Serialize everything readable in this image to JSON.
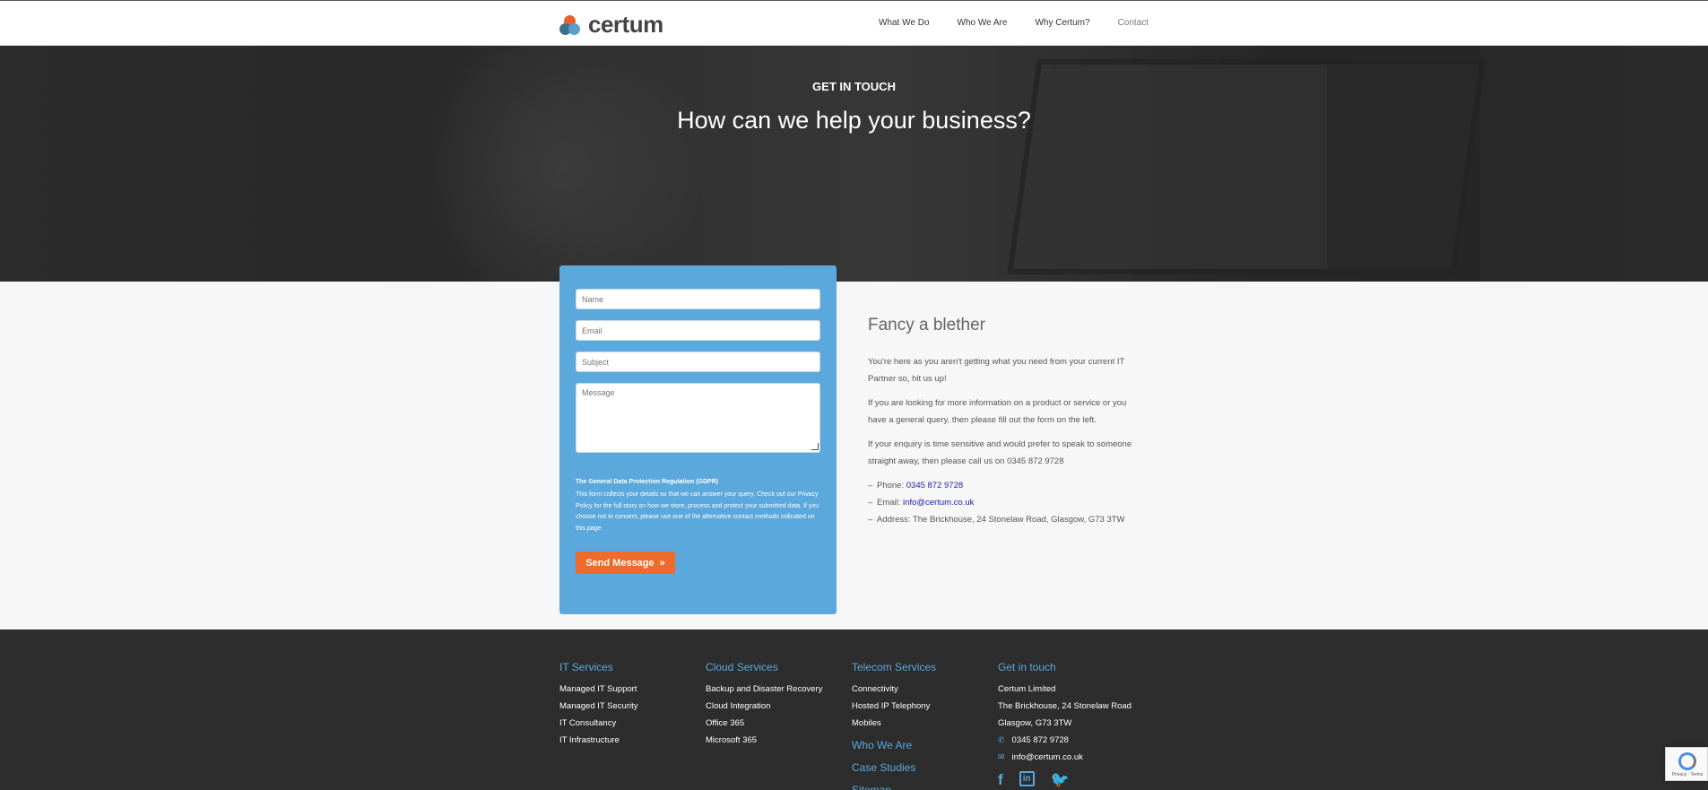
{
  "header": {
    "logo_text": "certum",
    "nav": [
      "What We Do",
      "Who We Are",
      "Why Certum?",
      "Contact"
    ]
  },
  "hero": {
    "eyebrow": "GET IN TOUCH",
    "title": "How can we help your business?"
  },
  "form": {
    "name_placeholder": "Name",
    "email_placeholder": "Email",
    "subject_placeholder": "Subject",
    "message_placeholder": "Message",
    "gdpr_title": "The General Data Protection Regulation (GDPR)",
    "gdpr_text": "This form collects your details so that we can answer your query. Check out our Privacy Policy for the full story on how we store, process and protect your submitted data. If you choose not to consent, please use one of the alternative contact methods indicated on this page.",
    "send_label": "Send Message",
    "send_icon": "»"
  },
  "info": {
    "title": "Fancy a blether",
    "p1": "You're here as you aren't getting what you need from your current IT Partner so, hit us up!",
    "p2": "If you are looking for more information on a product or service or you have a general query, then please fill out the form on the left.",
    "p3": "If your enquiry is time sensitive and would prefer to speak to someone straight away, then please call us on 0345 872 9728",
    "phone_label": "Phone: ",
    "phone": "0345 872 9728",
    "email_label": "Email: ",
    "email": "info@certum.co.uk",
    "address": "Address: The Brickhouse, 24 Stonelaw Road, Glasgow, G73 3TW"
  },
  "footer": {
    "it": {
      "title": "IT Services",
      "items": [
        "Managed IT Support",
        "Managed IT Security",
        "IT Consultancy",
        "IT Infrastructure"
      ]
    },
    "cloud": {
      "title": "Cloud Services",
      "items": [
        "Backup and Disaster Recovery",
        "Cloud Integration",
        "Office 365",
        "Microsoft 365"
      ]
    },
    "telecom": {
      "title": "Telecom Services",
      "items": [
        "Connectivity",
        "Hosted IP Telephony",
        "Mobiles"
      ],
      "links": [
        "Who We Are",
        "Case Studies",
        "Sitemap"
      ]
    },
    "contact": {
      "title": "Get in touch",
      "company": "Certum Limited",
      "address1": "The Brickhouse, 24 Stonelaw Road",
      "address2": "Glasgow, G73 3TW",
      "phone": "0345 872 9728",
      "email": "info@certum.co.uk"
    },
    "social": {
      "facebook": "f",
      "linkedin": "in",
      "twitter": "🐦"
    }
  },
  "recaptcha": {
    "text": "Privacy - Terms"
  },
  "colors": {
    "accent_blue": "#5ba8dc",
    "accent_orange": "#ee6b2b",
    "footer_bg": "#2d2d2d"
  }
}
